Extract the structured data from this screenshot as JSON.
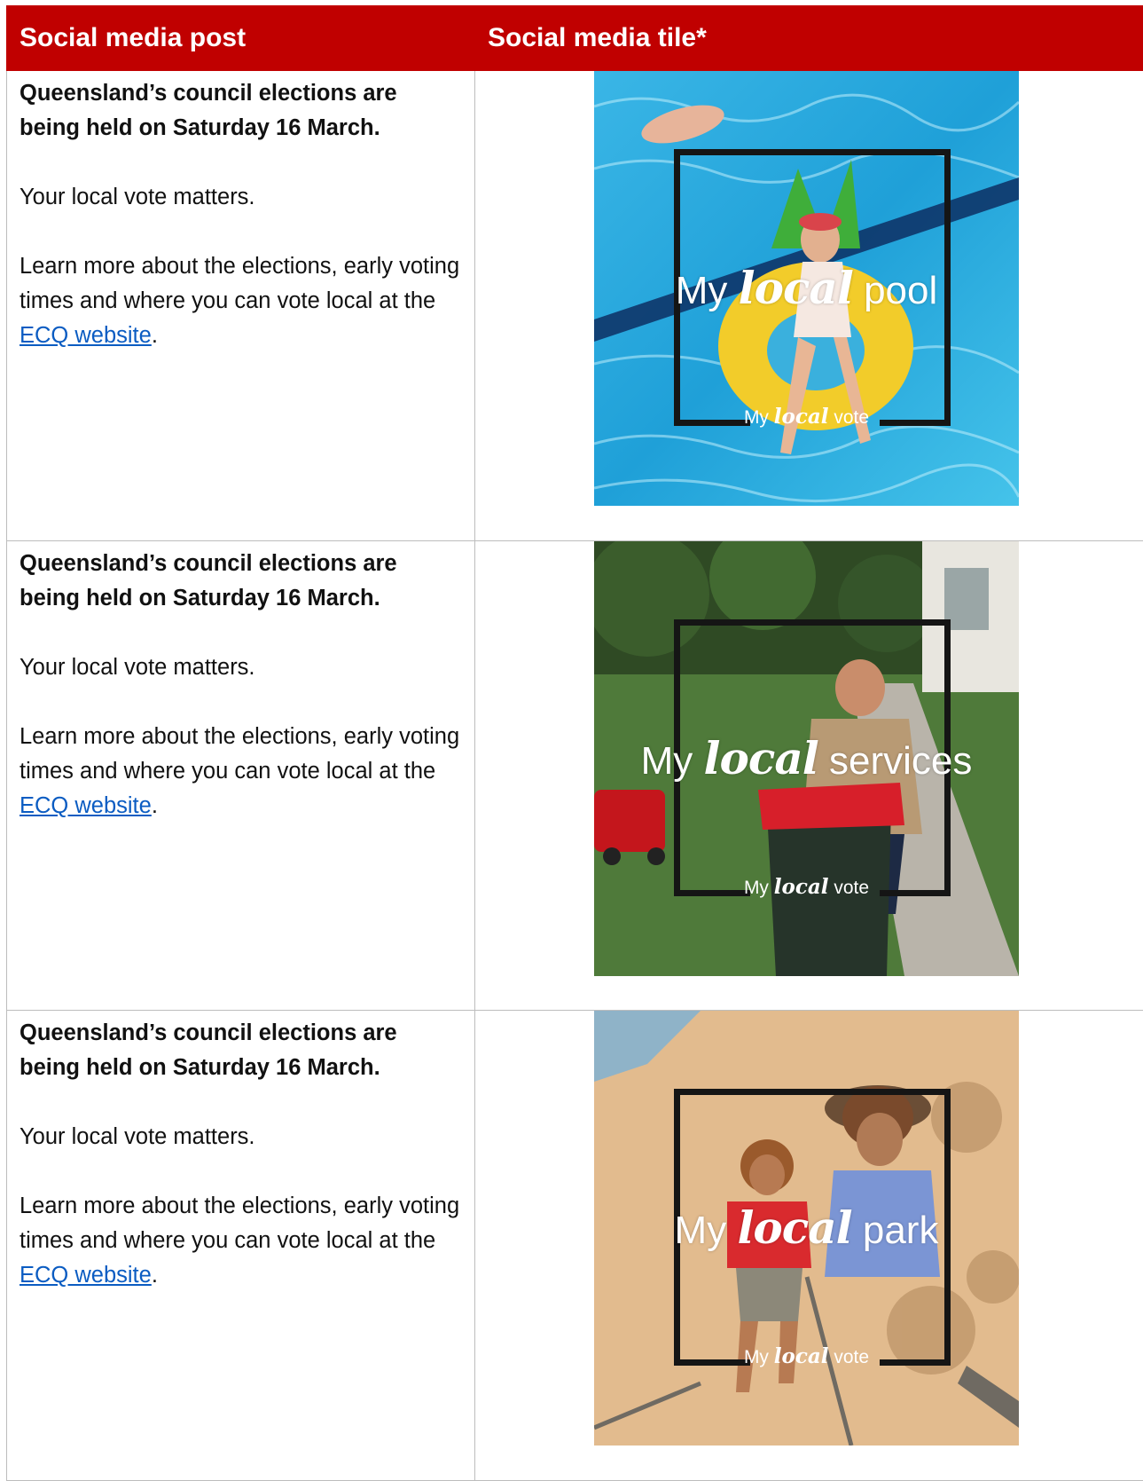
{
  "headers": {
    "post": "Social media post",
    "tile": "Social media tile*"
  },
  "rows": [
    {
      "headline": "Queensland’s council elections are being held on Saturday 16 March.",
      "line1": "Your local vote matters.",
      "learn_prefix": "Learn more about the elections, early voting times and where you can vote local at the ",
      "link": "ECQ website",
      "suffix": ".",
      "tile": {
        "my": "My",
        "local": "local",
        "place": "pool",
        "vote": "vote"
      }
    },
    {
      "headline": "Queensland’s council elections are being held on Saturday 16 March.",
      "line1": "Your local vote matters.",
      "learn_prefix": "Learn more about the elections, early voting times and where you can vote local at the ",
      "link": "ECQ website",
      "suffix": ".",
      "tile": {
        "my": "My",
        "local": "local",
        "place": "services",
        "vote": "vote"
      }
    },
    {
      "headline": "Queensland’s council elections are being held on Saturday 16 March.",
      "line1": "Your local vote matters.",
      "learn_prefix": "Learn more about the elections, early voting times and where you can vote local at the ",
      "link": "ECQ website",
      "suffix": ".",
      "tile": {
        "my": "My",
        "local": "local",
        "place": "park",
        "vote": "vote"
      }
    }
  ],
  "colors": {
    "header_bg": "#c00000",
    "link": "#0b5cc2"
  }
}
